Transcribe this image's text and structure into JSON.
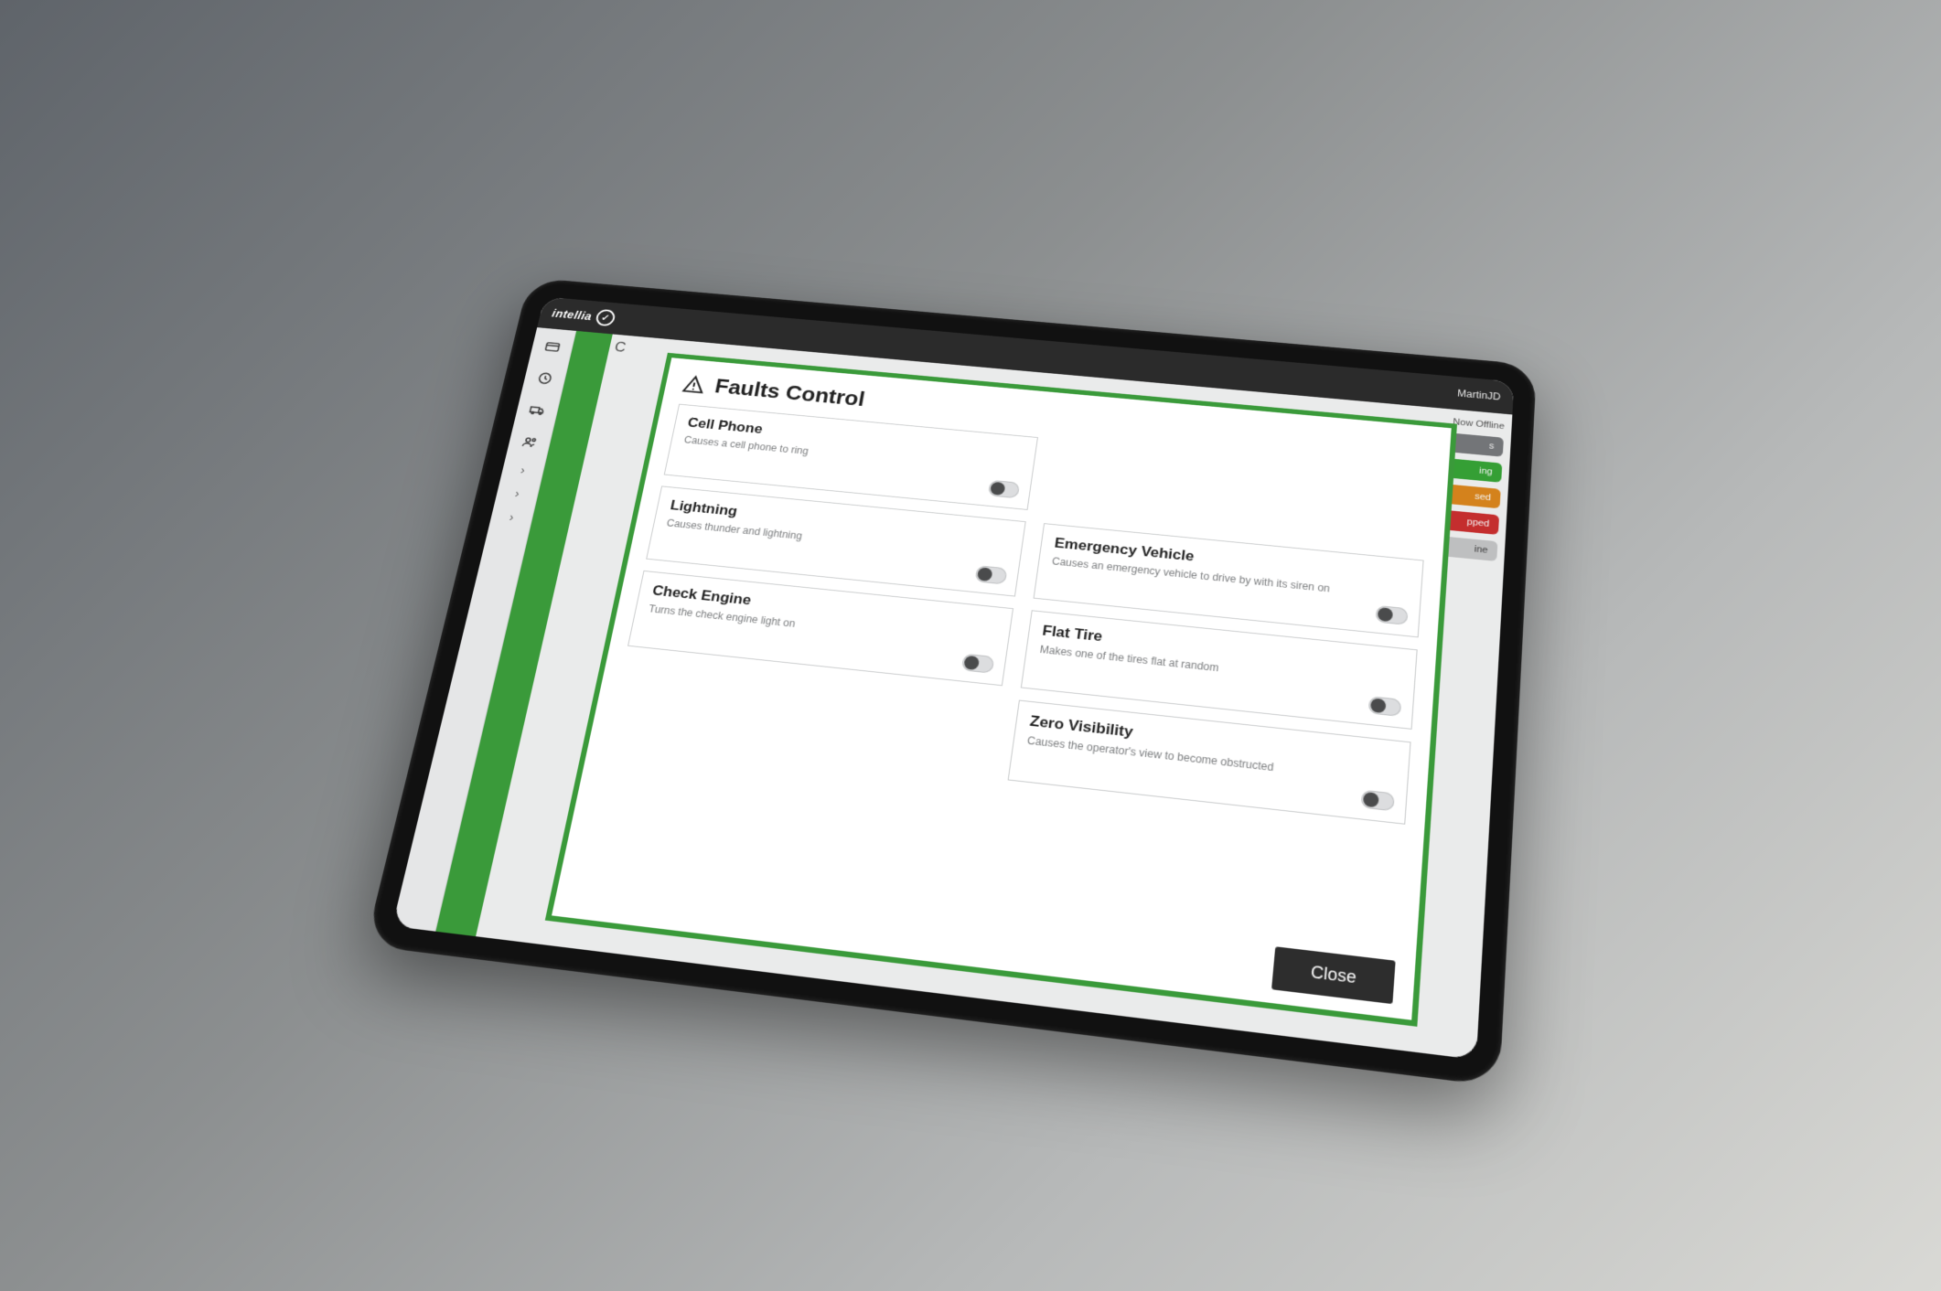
{
  "app": {
    "brand": "intellia",
    "user": "MartinJD"
  },
  "statusHeader": "Now Offline",
  "statusPills": [
    {
      "label": "s",
      "cls": "p-grey"
    },
    {
      "label": "ing",
      "cls": "p-green"
    },
    {
      "label": "sed",
      "cls": "p-orange"
    },
    {
      "label": "pped",
      "cls": "p-red"
    },
    {
      "label": "ine",
      "cls": "p-lite"
    }
  ],
  "modal": {
    "title": "Faults Control",
    "close": "Close",
    "faults": [
      {
        "name": "Cell Phone",
        "desc": "Causes a cell phone to ring"
      },
      {
        "name": "Lightning",
        "desc": "Causes thunder and lightning"
      },
      {
        "name": "Emergency Vehicle",
        "desc": "Causes an emergency vehicle to drive by with its siren on"
      },
      {
        "name": "Check Engine",
        "desc": "Turns the check engine light on"
      },
      {
        "name": "Flat Tire",
        "desc": "Makes one of the tires flat at random"
      },
      {
        "name": "Zero Visibility",
        "desc": "Causes the operator's view to become obstructed"
      }
    ]
  }
}
